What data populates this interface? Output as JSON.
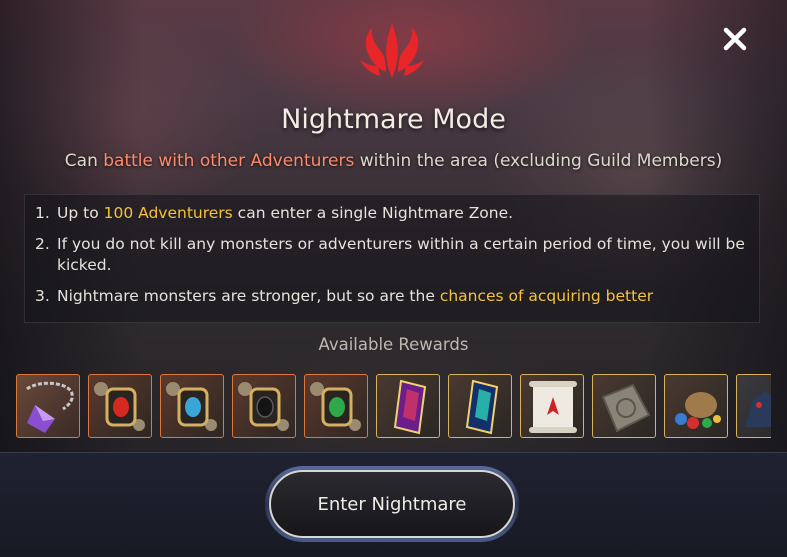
{
  "dialog": {
    "title": "Nightmare Mode",
    "close_icon": "close-icon",
    "emblem_icon": "demon-horns-emblem-icon"
  },
  "subtitle": {
    "pre": "Can ",
    "highlight": "battle with other Adventurers",
    "post": " within the area (excluding Guild Members)"
  },
  "rules": [
    {
      "num": "1.",
      "pre": "Up to ",
      "highlight": "100 Adventurers",
      "post": " can enter a single Nightmare Zone."
    },
    {
      "num": "2.",
      "pre": "If you do not kill any monsters or adventurers within a certain period of time, you will be kicked.",
      "highlight": "",
      "post": ""
    },
    {
      "num": "3.",
      "pre": "Nightmare monsters are stronger, but so are the ",
      "highlight": "chances of acquiring better",
      "post": ""
    }
  ],
  "rewards": {
    "title": "Available Rewards",
    "items": [
      {
        "icon": "amethyst-necklace-icon",
        "rarity": "orange"
      },
      {
        "icon": "red-gem-brooch-icon",
        "rarity": "orange"
      },
      {
        "icon": "blue-gem-brooch-icon",
        "rarity": "orange"
      },
      {
        "icon": "black-gem-brooch-icon",
        "rarity": "orange"
      },
      {
        "icon": "green-gem-brooch-icon",
        "rarity": "orange"
      },
      {
        "icon": "purple-crystal-icon",
        "rarity": "gold"
      },
      {
        "icon": "teal-crystal-icon",
        "rarity": "gold"
      },
      {
        "icon": "scroll-icon",
        "rarity": "gold"
      },
      {
        "icon": "stone-tablet-icon",
        "rarity": "gold"
      },
      {
        "icon": "treasure-pouch-icon",
        "rarity": "gold"
      },
      {
        "icon": "creature-icon",
        "rarity": "gold"
      }
    ]
  },
  "enter_button": {
    "label": "Enter Nightmare"
  },
  "colors": {
    "highlight_red": "#ff8a6a",
    "highlight_gold": "#f5c23a",
    "rarity_orange": "#e0763a",
    "rarity_gold": "#d9b25a",
    "emblem_red": "#e8262a"
  }
}
